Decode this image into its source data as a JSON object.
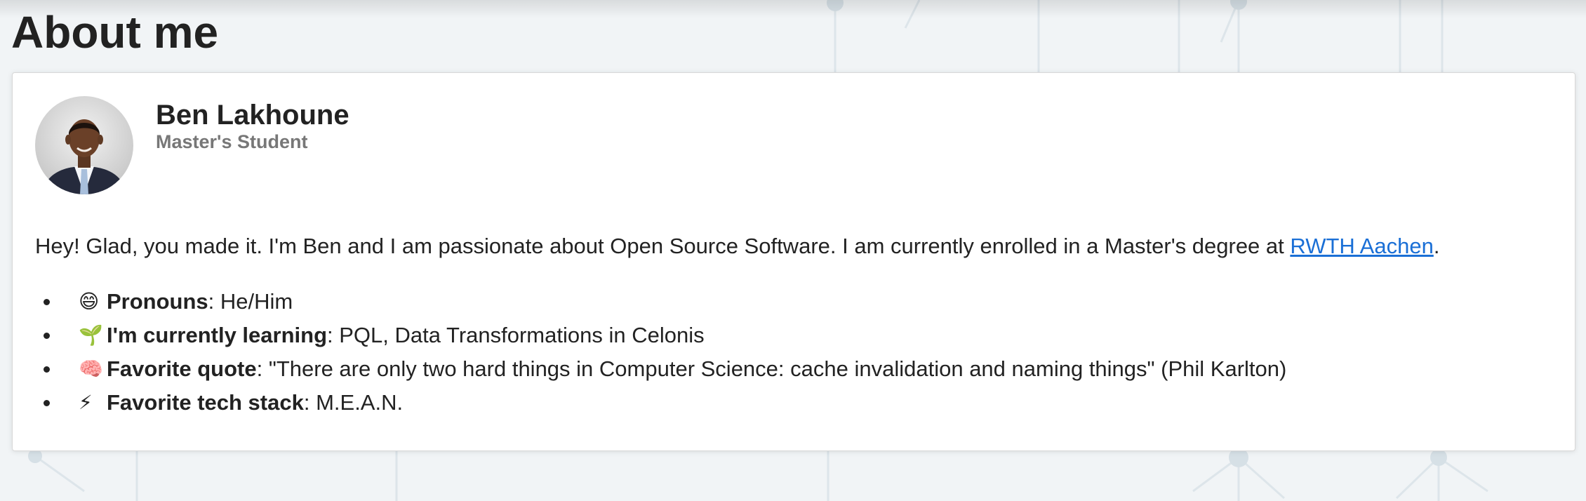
{
  "page": {
    "title": "About me"
  },
  "profile": {
    "name": "Ben Lakhoune",
    "role": "Master's Student",
    "avatar_icon": "person-photo"
  },
  "intro": {
    "text": "Hey! Glad, you made it. I'm Ben and I am passionate about Open Source Software. I am currently enrolled in a Master's degree at ",
    "link_label": "RWTH Aachen",
    "trailing": "."
  },
  "facts": [
    {
      "emoji": "😄",
      "icon": "grinning-face-icon",
      "label": "Pronouns",
      "value": ": He/Him"
    },
    {
      "emoji": "🌱",
      "icon": "seedling-icon",
      "label": "I'm currently learning",
      "value": ": PQL, Data Transformations in Celonis"
    },
    {
      "emoji": "🧠",
      "icon": "brain-icon",
      "label": "Favorite quote",
      "value": ": \"There are only two hard things in Computer Science: cache invalidation and naming things\" (Phil Karlton)"
    },
    {
      "emoji": "⚡",
      "icon": "lightning-icon",
      "label": "Favorite tech stack",
      "value": ": M.E.A.N."
    }
  ],
  "colors": {
    "link": "#1a6fd6",
    "text": "#222222",
    "muted": "#777777",
    "card_background": "#ffffff",
    "page_background": "#f1f4f6"
  }
}
